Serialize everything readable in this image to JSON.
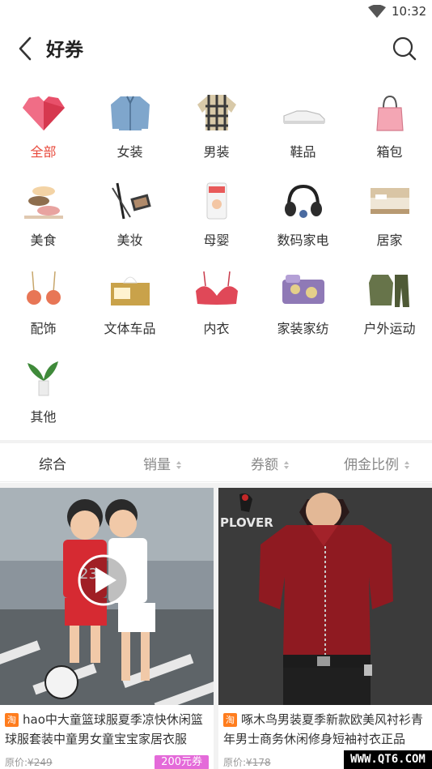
{
  "status_bar": {
    "time": "10:32"
  },
  "header": {
    "title": "好券"
  },
  "categories": [
    {
      "label": "全部",
      "active": true
    },
    {
      "label": "女装"
    },
    {
      "label": "男装"
    },
    {
      "label": "鞋品"
    },
    {
      "label": "箱包"
    },
    {
      "label": "美食"
    },
    {
      "label": "美妆"
    },
    {
      "label": "母婴"
    },
    {
      "label": "数码家电"
    },
    {
      "label": "居家"
    },
    {
      "label": "配饰"
    },
    {
      "label": "文体车品"
    },
    {
      "label": "内衣"
    },
    {
      "label": "家装家纺"
    },
    {
      "label": "户外运动"
    },
    {
      "label": "其他"
    }
  ],
  "sort_options": [
    {
      "label": "综合",
      "active": true
    },
    {
      "label": "销量"
    },
    {
      "label": "券额"
    },
    {
      "label": "佣金比例"
    }
  ],
  "products": [
    {
      "source_badge": "淘",
      "title": "hao中大童篮球服夏季凉快休闲篮球服套装中童男女童宝宝家居衣服",
      "price_label": "原价:",
      "currency": "¥",
      "orig_price": "249",
      "coupon": "200元券"
    },
    {
      "source_badge": "淘",
      "title": "啄木鸟男装夏季新款欧美风衬衫青年男士商务休闲修身短袖衬衣正品",
      "price_label": "原价:",
      "currency": "¥",
      "orig_price": "178",
      "image_brand_text": "PLOVER"
    }
  ],
  "jersey_number": "23",
  "watermark": "WWW.QT6.COM",
  "colors": {
    "accent": "#e84a3c",
    "coupon": "#e46ad9",
    "taobao": "#ff7d1e"
  }
}
